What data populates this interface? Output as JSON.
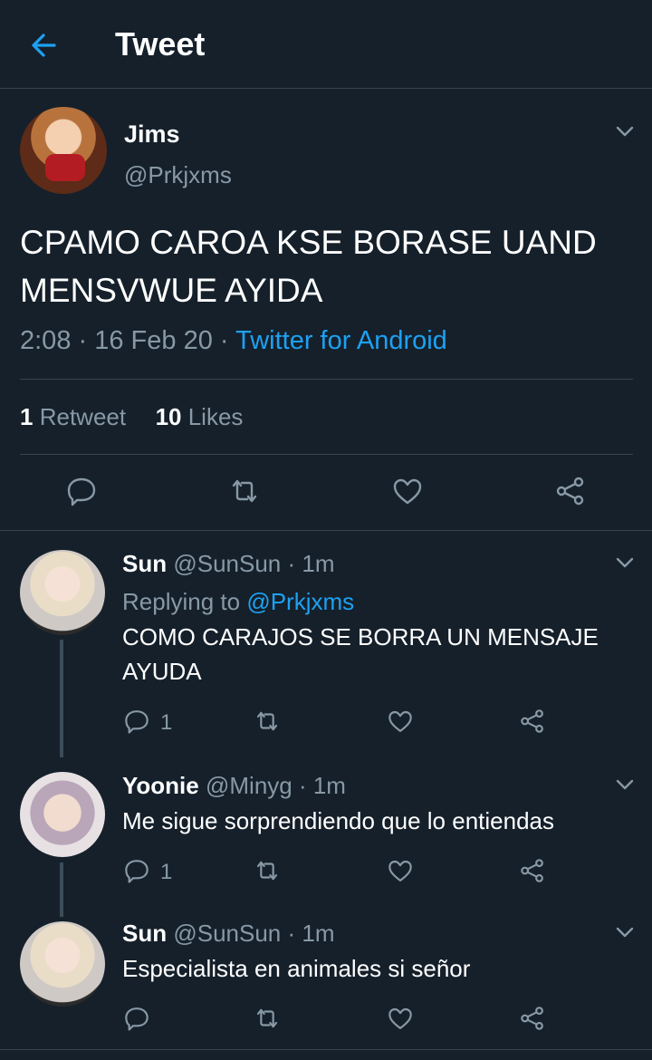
{
  "header": {
    "title": "Tweet"
  },
  "tweet": {
    "name": "Jims",
    "handle": "@Prkjxms",
    "text": "CPAMO CAROA KSE BORASE UAND MENSVWUE AYIDA",
    "time": "2:08",
    "date": "16 Feb 20",
    "source": "Twitter for Android",
    "retweet_count": "1",
    "retweet_label": "Retweet",
    "likes_count": "10",
    "likes_label": "Likes"
  },
  "replies": [
    {
      "name": "Sun",
      "handle": "@SunSun",
      "time": "1m",
      "replying_label": "Replying to",
      "replying_to": "@Prkjxms",
      "text": "COMO CARAJOS SE BORRA UN MENSAJE AYUDA",
      "reply_count": "1"
    },
    {
      "name": "Yoonie",
      "handle": "@Minyg",
      "time": "1m",
      "text": "Me sigue sorprendiendo que lo entiendas",
      "reply_count": "1"
    },
    {
      "name": "Sun",
      "handle": "@SunSun",
      "time": "1m",
      "text": "Especialista en animales si señor"
    }
  ],
  "colors": {
    "background": "#15202b",
    "accent": "#1da1f2",
    "muted": "#8899a6",
    "divider": "#38444d"
  },
  "icons": [
    "back-arrow-icon",
    "chevron-down-icon",
    "reply-icon",
    "retweet-icon",
    "like-icon",
    "share-icon"
  ]
}
